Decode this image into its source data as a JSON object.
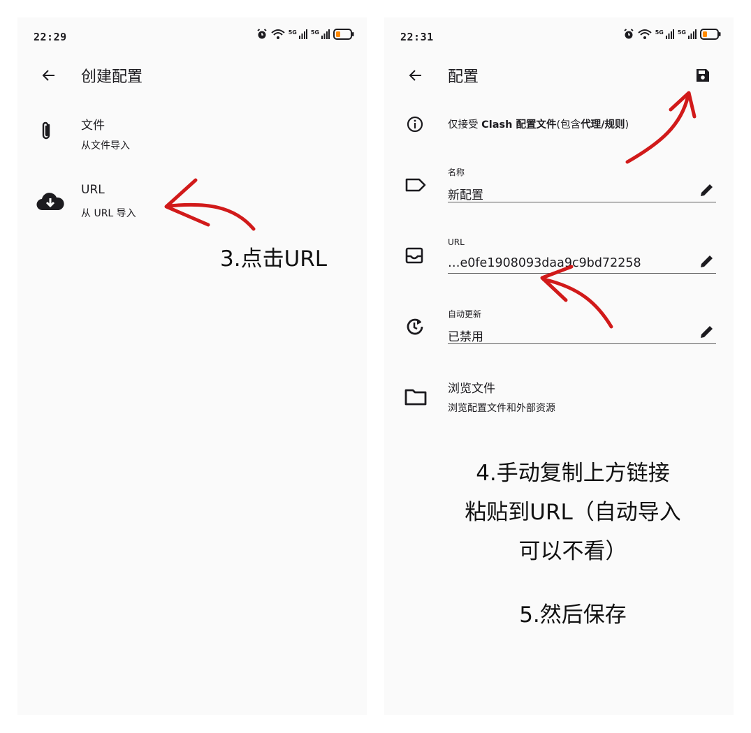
{
  "left": {
    "status_time": "22:29",
    "title": "创建配置",
    "items": [
      {
        "title": "文件",
        "subtitle": "从文件导入",
        "icon": "paperclip-icon"
      },
      {
        "title": "URL",
        "subtitle": "从 URL 导入",
        "icon": "cloud-download-icon"
      }
    ],
    "annotation": "3.点击URL"
  },
  "right": {
    "status_time": "22:31",
    "title": "配置",
    "info": {
      "prefix": "仅接受 ",
      "bold1": "Clash 配置文件",
      "middle": "(包含",
      "bold2": "代理",
      "slash": "/",
      "bold3": "规则",
      "suffix": ")"
    },
    "fields": [
      {
        "label": "名称",
        "value": "新配置",
        "icon": "label-tag-icon"
      },
      {
        "label": "URL",
        "value": "…e0fe1908093daa9c9bd72258",
        "icon": "inbox-tray-icon"
      },
      {
        "label": "自动更新",
        "value": "已禁用",
        "icon": "update-clock-icon"
      }
    ],
    "browse": {
      "title": "浏览文件",
      "subtitle": "浏览配置文件和外部资源",
      "icon": "folder-icon"
    },
    "annotation4": [
      "4.手动复制上方链接",
      "粘贴到URL（自动导入",
      "可以不看）"
    ],
    "annotation5": "5.然后保存"
  },
  "colors": {
    "arrow": "#d11a1a",
    "background": "#fafafa",
    "text": "#1c1b1f",
    "battery": "#ff8a00"
  },
  "status_signal": "5G"
}
